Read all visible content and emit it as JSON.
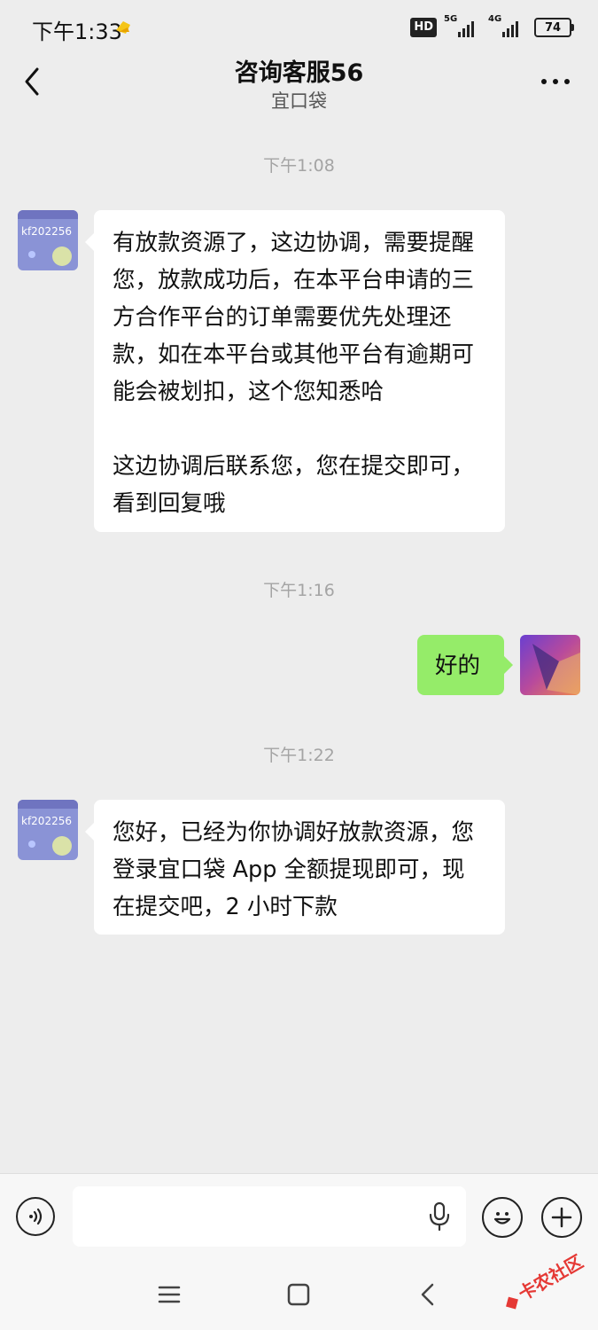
{
  "status_bar": {
    "time": "下午1:33",
    "hd_label": "HD",
    "net1_label": "5G",
    "net2_label": "4G",
    "battery": "74"
  },
  "header": {
    "title": "咨询客服56",
    "subtitle": "宜口袋"
  },
  "messages": [
    {
      "type": "timestamp",
      "text": "下午1:08"
    },
    {
      "type": "incoming",
      "avatar_text": "kf202256",
      "text": "有放款资源了，这边协调，需要提醒您，放款成功后，在本平台申请的三方合作平台的订单需要优先处理还款，如在本平台或其他平台有逾期可能会被划扣，这个您知悉哈\n\n这边协调后联系您，您在提交即可，看到回复哦"
    },
    {
      "type": "timestamp",
      "text": "下午1:16"
    },
    {
      "type": "outgoing",
      "text": "好的"
    },
    {
      "type": "timestamp",
      "text": "下午1:22"
    },
    {
      "type": "incoming",
      "avatar_text": "kf202256",
      "text": "您好，已经为你协调好放款资源，您登录宜口袋 App 全额提现即可，现在提交吧，2 小时下款"
    }
  ],
  "input": {
    "value": "",
    "placeholder": ""
  },
  "watermark": {
    "text": "卡农社区"
  },
  "colors": {
    "background": "#ededed",
    "outgoing_bubble": "#95ec69",
    "incoming_bubble": "#ffffff",
    "timestamp": "#a4a4a4"
  },
  "icons": [
    "back-arrow",
    "more-dots",
    "voice",
    "mic",
    "emoji",
    "plus",
    "menu",
    "home",
    "back"
  ]
}
